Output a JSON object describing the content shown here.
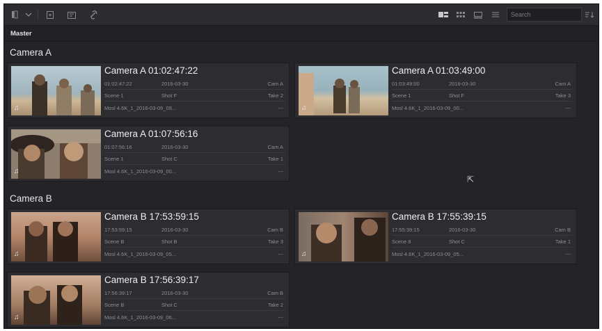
{
  "toolbar": {
    "search_placeholder": "Search"
  },
  "breadcrumb": "Master",
  "sections": [
    {
      "title": "Camera A",
      "clips": [
        {
          "title": "Camera A  01:02:47:22",
          "timecode": "01:02:47:22",
          "date": "2016-03-30",
          "camera": "Cam A",
          "scene": "Scene 1",
          "shot": "Shot F",
          "take": "Take 2",
          "file": "Mosl 4.6K_1_2016-03-09_09...",
          "dash": "---"
        },
        {
          "title": "Camera A  01:03:49:00",
          "timecode": "01:03:49:00",
          "date": "2016-03-30",
          "camera": "Cam A",
          "scene": "Scene 1",
          "shot": "Shot F",
          "take": "Take 3",
          "file": "Mosl 4.6K_1_2016-03-09_00...",
          "dash": "---"
        },
        {
          "title": "Camera A  01:07:56:16",
          "timecode": "01:07:56:16",
          "date": "2016-03-30",
          "camera": "Cam A",
          "scene": "Scene 1",
          "shot": "Shot C",
          "take": "Take 1",
          "file": "Mosl 4.6K_1_2016-03-09_00...",
          "dash": "---"
        }
      ]
    },
    {
      "title": "Camera B",
      "clips": [
        {
          "title": "Camera B  17:53:59:15",
          "timecode": "17:53:59:15",
          "date": "2016-03-30",
          "camera": "Cam B",
          "scene": "Scene B",
          "shot": "Shot B",
          "take": "Take 3",
          "file": "Mosl 4.6K_1_2016-03-09_05...",
          "dash": "---"
        },
        {
          "title": "Camera B  17:55:39:15",
          "timecode": "17:55:39:15",
          "date": "2016-03-30",
          "camera": "Cam B",
          "scene": "Scene 8",
          "shot": "Shot C",
          "take": "Take 1",
          "file": "Mosl 4.6K_1_2016-03-09_05...",
          "dash": "---"
        },
        {
          "title": "Camera B  17:56:39:17",
          "timecode": "17:56:39:17",
          "date": "2016-03-30",
          "camera": "Cam B",
          "scene": "Scene B",
          "shot": "Shot C",
          "take": "Take 2",
          "file": "Mosl 4.6K_1_2016-03-09_06...",
          "dash": "---"
        }
      ]
    }
  ]
}
